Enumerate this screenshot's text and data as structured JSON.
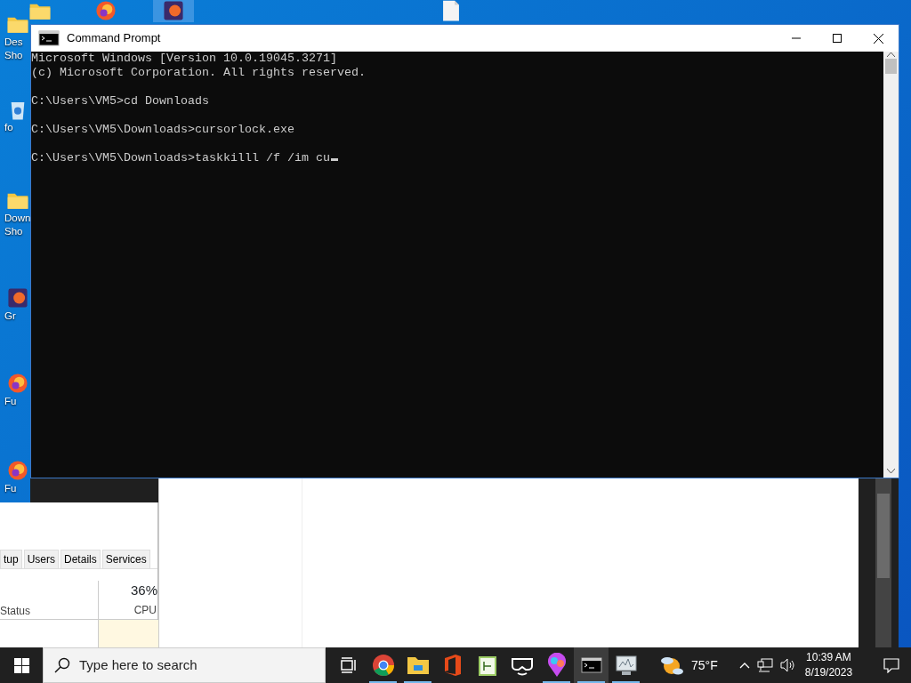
{
  "desktop_icons": [
    {
      "kind": "folder",
      "lines": [
        "Des",
        "Sho"
      ]
    },
    {
      "kind": "recycle",
      "lines": [
        "fo"
      ]
    },
    {
      "kind": "folder",
      "lines": [
        "Down",
        "Sho"
      ]
    },
    {
      "kind": "app",
      "lines": [
        "Gr"
      ]
    },
    {
      "kind": "firefox",
      "lines": [
        "Fu"
      ]
    },
    {
      "kind": "firefox",
      "lines": [
        "Fu"
      ]
    }
  ],
  "top_icons": [
    {
      "kind": "folder",
      "selected": false
    },
    {
      "kind": "firefox",
      "selected": false
    },
    {
      "kind": "app",
      "selected": true
    },
    {
      "kind": "file",
      "selected": false
    }
  ],
  "task_manager": {
    "tabs": [
      {
        "label": "tup",
        "selected": false
      },
      {
        "label": "Users",
        "selected": false
      },
      {
        "label": "Details",
        "selected": false
      },
      {
        "label": "Services",
        "selected": false
      }
    ],
    "cpu_value": "36%",
    "cpu_label": "CPU",
    "status_label": "Status"
  },
  "command_prompt": {
    "title": "Command Prompt",
    "blocks": [
      [
        "Microsoft Windows [Version 10.0.19045.3271]",
        "(c) Microsoft Corporation. All rights reserved."
      ],
      [
        "C:\\Users\\VM5>cd Downloads"
      ],
      [
        "C:\\Users\\VM5\\Downloads>cursorlock.exe"
      ],
      [
        "C:\\Users\\VM5\\Downloads>taskkilll /f /im cu"
      ]
    ]
  },
  "taskbar": {
    "search_placeholder": "Type here to search",
    "apps": [
      {
        "kind": "taskview",
        "active": false,
        "open": false
      },
      {
        "kind": "chrome",
        "active": false,
        "open": true
      },
      {
        "kind": "explorer",
        "active": false,
        "open": true
      },
      {
        "kind": "office",
        "active": false,
        "open": false
      },
      {
        "kind": "notepad",
        "active": false,
        "open": false
      },
      {
        "kind": "headset",
        "active": false,
        "open": false
      },
      {
        "kind": "paint",
        "active": false,
        "open": true
      },
      {
        "kind": "console",
        "active": true,
        "open": true
      },
      {
        "kind": "monitor",
        "active": false,
        "open": true
      }
    ],
    "weather": "75°F",
    "time": "10:39 AM",
    "date": "8/19/2023"
  }
}
